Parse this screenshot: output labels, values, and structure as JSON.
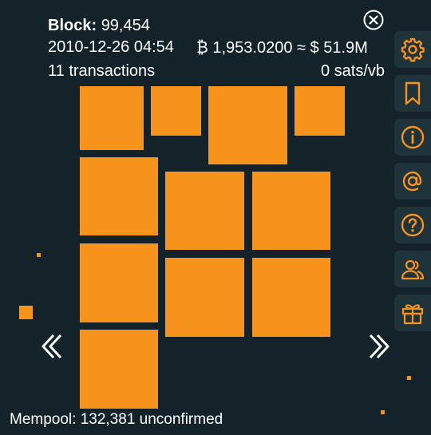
{
  "block": {
    "label": "Block:",
    "height": "99,454",
    "timestamp": "2010-12-26 04:54",
    "value": "₿ 1,953.0200 ≈ $ 51.9M",
    "tx_count": "11 transactions",
    "fee_rate": "0 sats/vb"
  },
  "mempool": {
    "text": "Mempool: 132,381 unconfirmed"
  },
  "colors": {
    "background": "#132329",
    "tx_fill": "#f7931a",
    "sidebar_button": "#1f333b"
  },
  "sidebar": {
    "items": [
      {
        "icon": "gear-icon",
        "name": "settings"
      },
      {
        "icon": "bookmark-icon",
        "name": "bookmarks"
      },
      {
        "icon": "info-icon",
        "name": "info"
      },
      {
        "icon": "at-icon",
        "name": "contact"
      },
      {
        "icon": "help-icon",
        "name": "help"
      },
      {
        "icon": "users-icon",
        "name": "community"
      },
      {
        "icon": "gift-icon",
        "name": "donate"
      }
    ]
  },
  "icons": {
    "close": "close-icon",
    "prev": "chevron-left-icon",
    "next": "chevron-right-icon"
  }
}
